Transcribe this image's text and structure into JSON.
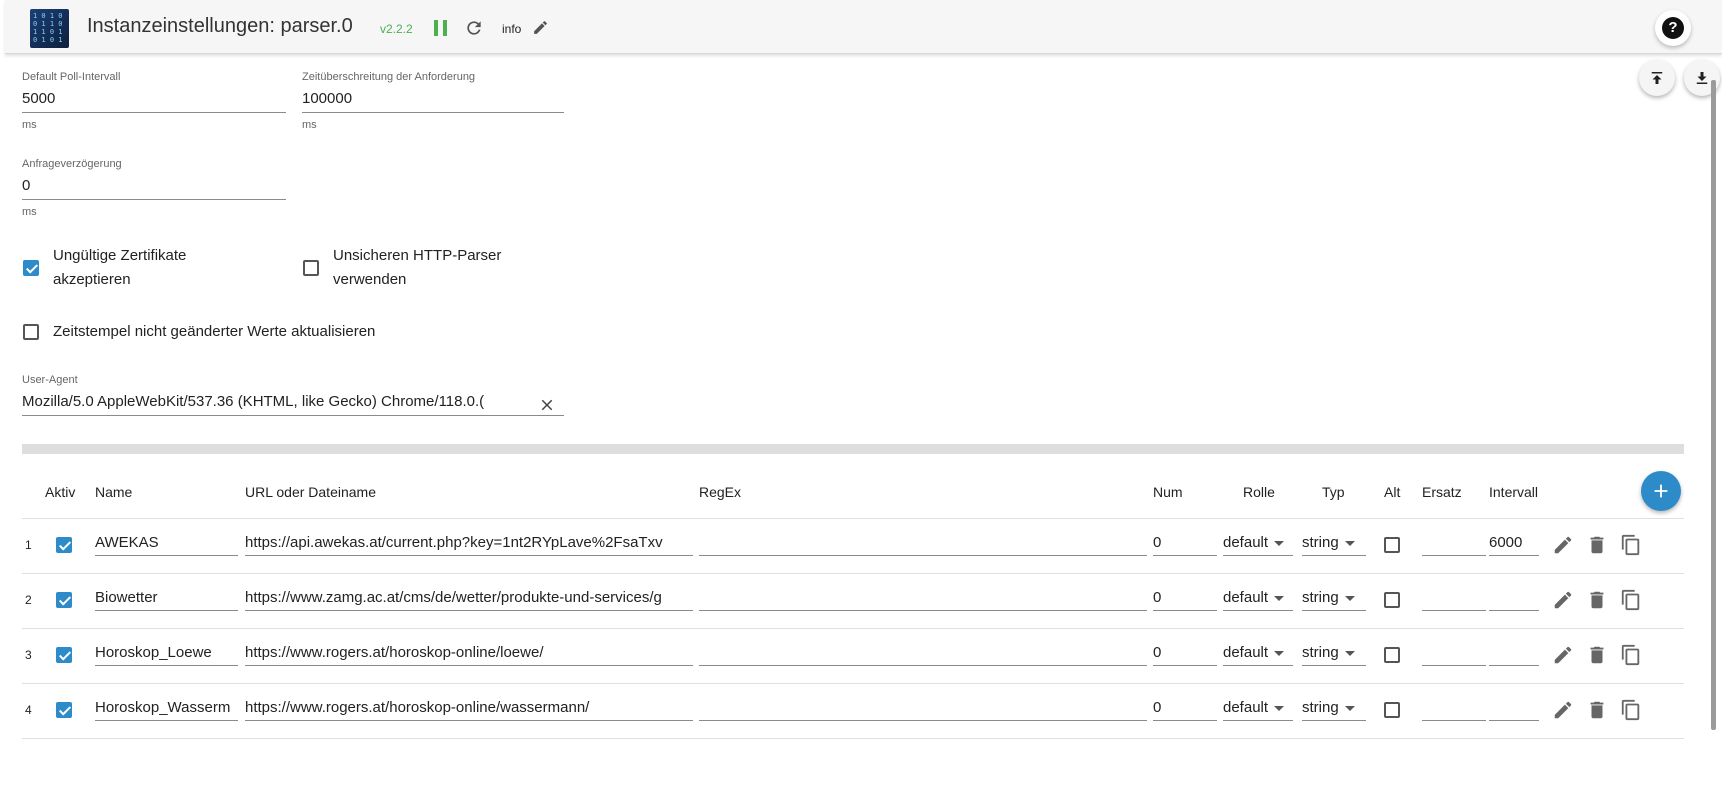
{
  "header": {
    "title": "Instanzeinstellungen: parser.0",
    "version": "v2.2.2",
    "info_label": "info",
    "logo_text": "1 0 1 0\n0 1 1 0\n1 1 0 1\n0 1 0 1"
  },
  "fields": {
    "poll_interval": {
      "label": "Default Poll-Intervall",
      "value": "5000",
      "unit": "ms"
    },
    "timeout": {
      "label": "Zeitüberschreitung der Anforderung",
      "value": "100000",
      "unit": "ms"
    },
    "request_delay": {
      "label": "Anfrageverzögerung",
      "value": "0",
      "unit": "ms"
    },
    "user_agent": {
      "label": "User-Agent",
      "value": "Mozilla/5.0 AppleWebKit/537.36 (KHTML, like Gecko) Chrome/118.0.("
    }
  },
  "checkboxes": {
    "invalid_certs": {
      "label_line1": "Ungültige Zertifikate",
      "label_line2": "akzeptieren",
      "checked": true
    },
    "insecure_http": {
      "label_line1": "Unsicheren HTTP-Parser",
      "label_line2": "verwenden",
      "checked": false
    },
    "update_unchanged": {
      "label": "Zeitstempel nicht geänderter Werte aktualisieren",
      "checked": false
    }
  },
  "table": {
    "columns": {
      "aktiv": "Aktiv",
      "name": "Name",
      "url": "URL oder Dateiname",
      "regex": "RegEx",
      "num": "Num",
      "rolle": "Rolle",
      "typ": "Typ",
      "alt": "Alt",
      "ersatz": "Ersatz",
      "intervall": "Intervall"
    },
    "rows": [
      {
        "index": "1",
        "active": true,
        "name": "AWEKAS",
        "url": "https://api.awekas.at/current.php?key=1nt2RYpLave%2FsaTxv",
        "regex": "",
        "num": "0",
        "rolle": "default",
        "typ": "string",
        "alt": false,
        "ersatz": "",
        "intervall": "6000"
      },
      {
        "index": "2",
        "active": true,
        "name": "Biowetter",
        "url": "https://www.zamg.ac.at/cms/de/wetter/produkte-und-services/g",
        "regex": "",
        "num": "0",
        "rolle": "default",
        "typ": "string",
        "alt": false,
        "ersatz": "",
        "intervall": ""
      },
      {
        "index": "3",
        "active": true,
        "name": "Horoskop_Loewe",
        "url": "https://www.rogers.at/horoskop-online/loewe/",
        "regex": "",
        "num": "0",
        "rolle": "default",
        "typ": "string",
        "alt": false,
        "ersatz": "",
        "intervall": ""
      },
      {
        "index": "4",
        "active": true,
        "name": "Horoskop_Wasserm",
        "url": "https://www.rogers.at/horoskop-online/wassermann/",
        "regex": "",
        "num": "0",
        "rolle": "default",
        "typ": "string",
        "alt": false,
        "ersatz": "",
        "intervall": ""
      }
    ]
  },
  "colors": {
    "accent": "#2e8bc9",
    "status_green": "#4caf50"
  }
}
